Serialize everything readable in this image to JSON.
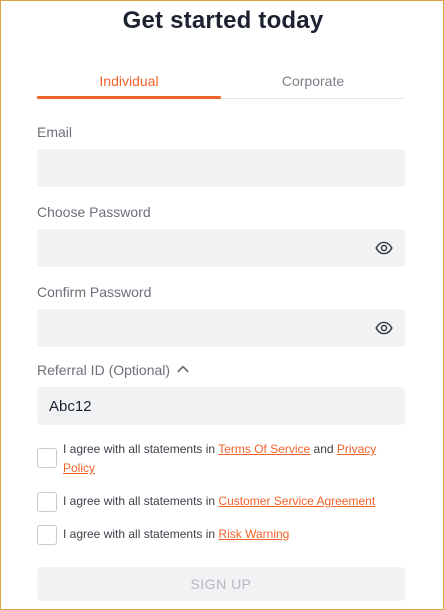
{
  "title": "Get started today",
  "tabs": [
    {
      "label": "Individual",
      "active": true
    },
    {
      "label": "Corporate",
      "active": false
    }
  ],
  "form": {
    "email": {
      "label": "Email",
      "value": ""
    },
    "password": {
      "label": "Choose Password",
      "value": "",
      "icon": "eye-icon"
    },
    "confirm": {
      "label": "Confirm Password",
      "value": "",
      "icon": "eye-icon"
    },
    "referral": {
      "label": "Referral ID (Optional)",
      "value": "Abc12",
      "toggle_icon": "chevron-up-icon"
    }
  },
  "agreements": [
    {
      "prefix": "I agree with all statements in ",
      "link1": "Terms Of Service",
      "middle": " and ",
      "link2": "Privacy Policy"
    },
    {
      "prefix": "I agree with all statements in ",
      "link1": "Customer Service Agreement"
    },
    {
      "prefix": "I agree with all statements in ",
      "link1": "Risk Warning"
    }
  ],
  "submit": {
    "label": "SIGN UP",
    "enabled": false
  },
  "colors": {
    "accent": "#f0622a",
    "field_bg": "#f1f2f4",
    "title": "#1c2230",
    "frame": "#d9a441"
  }
}
